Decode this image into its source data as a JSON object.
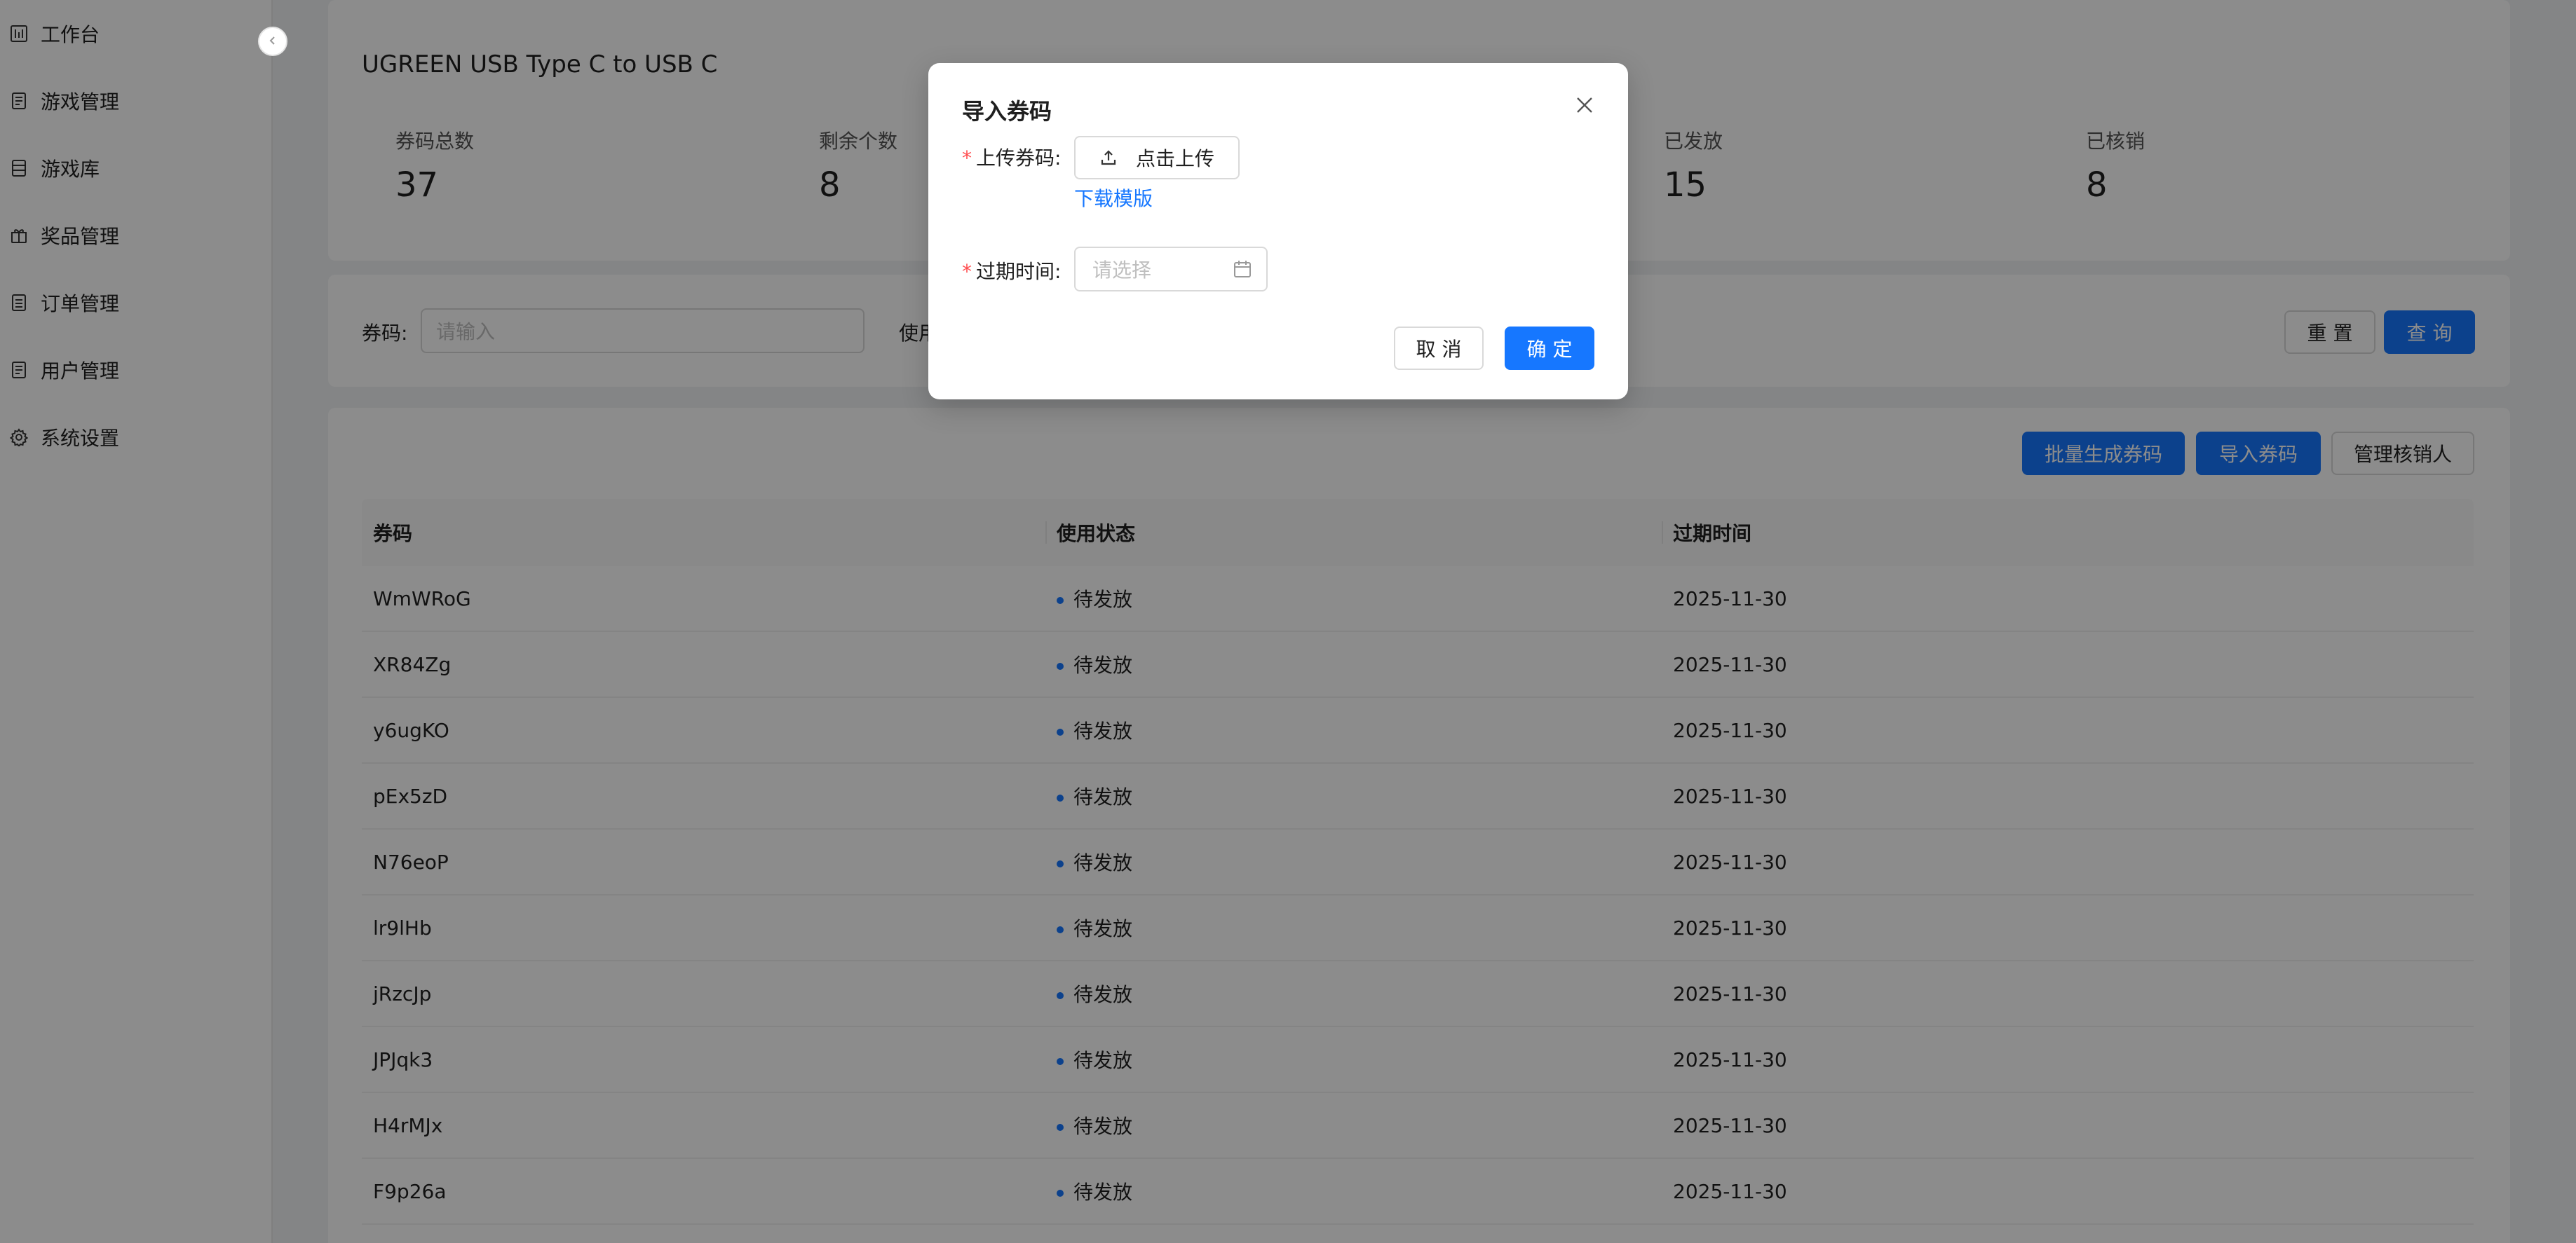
{
  "sidebar": {
    "collapse_icon": "chevron-left",
    "items": [
      {
        "label": "工作台",
        "icon": "dashboard-icon"
      },
      {
        "label": "游戏管理",
        "icon": "document-icon"
      },
      {
        "label": "游戏库",
        "icon": "list-icon"
      },
      {
        "label": "奖品管理",
        "icon": "gift-icon"
      },
      {
        "label": "订单管理",
        "icon": "order-icon"
      },
      {
        "label": "用户管理",
        "icon": "user-doc-icon"
      },
      {
        "label": "系统设置",
        "icon": "gear-icon"
      }
    ]
  },
  "product": {
    "title": "UGREEN USB Type C to USB C"
  },
  "stats": [
    {
      "label": "券码总数",
      "value": "37"
    },
    {
      "label": "剩余个数",
      "value": "8"
    },
    {
      "label": "已发放",
      "value": "15"
    },
    {
      "label": "已核销",
      "value": "8"
    }
  ],
  "filter": {
    "code_label": "券码:",
    "code_placeholder": "请输入",
    "status_label_partial": "使用",
    "reset_label": "重 置",
    "query_label": "查 询"
  },
  "toolbar": {
    "batch_generate_label": "批量生成券码",
    "import_label": "导入券码",
    "manage_verifier_label": "管理核销人"
  },
  "table": {
    "columns": [
      "券码",
      "使用状态",
      "过期时间"
    ],
    "rows": [
      {
        "code": "WmWRoG",
        "status": "待发放",
        "expire": "2025-11-30"
      },
      {
        "code": "XR84Zg",
        "status": "待发放",
        "expire": "2025-11-30"
      },
      {
        "code": "y6ugKO",
        "status": "待发放",
        "expire": "2025-11-30"
      },
      {
        "code": "pEx5zD",
        "status": "待发放",
        "expire": "2025-11-30"
      },
      {
        "code": "N76eoP",
        "status": "待发放",
        "expire": "2025-11-30"
      },
      {
        "code": "lr9lHb",
        "status": "待发放",
        "expire": "2025-11-30"
      },
      {
        "code": "jRzcJp",
        "status": "待发放",
        "expire": "2025-11-30"
      },
      {
        "code": "JPJqk3",
        "status": "待发放",
        "expire": "2025-11-30"
      },
      {
        "code": "H4rMJx",
        "status": "待发放",
        "expire": "2025-11-30"
      },
      {
        "code": "F9p26a",
        "status": "待发放",
        "expire": "2025-11-30"
      }
    ]
  },
  "modal": {
    "title": "导入券码",
    "upload_label": "上传券码:",
    "upload_button": "点击上传",
    "download_template": "下载模版",
    "expire_label": "过期时间:",
    "expire_placeholder": "请选择",
    "cancel_label": "取 消",
    "ok_label": "确 定"
  },
  "colors": {
    "primary": "#1677ff",
    "required": "#ff4d4f",
    "mask": "rgba(0,0,0,0.45)"
  }
}
